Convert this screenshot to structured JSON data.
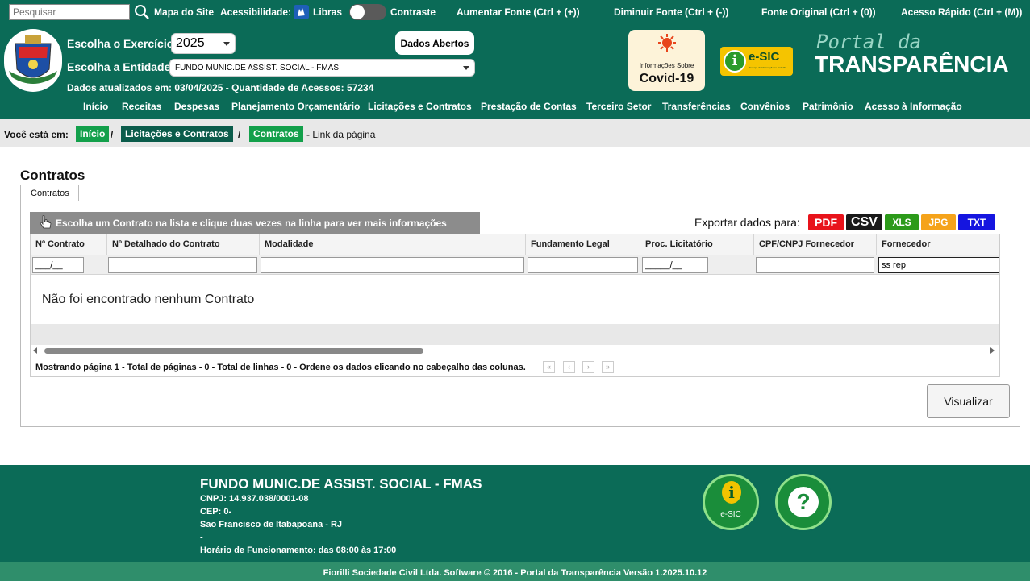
{
  "topbar": {
    "search_placeholder": "Pesquisar",
    "sitemap": "Mapa do Site",
    "accessibility": "Acessibilidade:",
    "libras": "Libras",
    "contrast": "Contraste",
    "increase_font": "Aumentar Fonte (Ctrl + (+))",
    "decrease_font": "Diminuir Fonte (Ctrl + (-))",
    "original_font": "Fonte Original (Ctrl + (0))",
    "quick_access": "Acesso Rápido (Ctrl + (M))"
  },
  "header": {
    "exercise_label": "Escolha o Exercício:",
    "exercise_value": "2025",
    "entity_label": "Escolha a Entidade:",
    "entity_value": "FUNDO MUNIC.DE ASSIST. SOCIAL - FMAS",
    "updated": "Dados atualizados em: 03/04/2025 - Quantidade de Acessos: 57234",
    "open_data": "Dados Abertos",
    "covid_small": "Informações Sobre",
    "covid_big": "Covid-19",
    "esic": "e-SIC",
    "esic_sub": "Serviço de Informação ao Cidadão",
    "portal_line1": "Portal da",
    "portal_line2": "TRANSPARÊNCIA"
  },
  "nav": [
    "Início",
    "Receitas",
    "Despesas",
    "Planejamento Orçamentário",
    "Licitações e Contratos",
    "Prestação de Contas",
    "Terceiro Setor",
    "Transferências",
    "Convênios",
    "Patrimônio",
    "Acesso à Informação"
  ],
  "breadcrumb": {
    "prefix": "Você está em:",
    "items": [
      "Início",
      "Licitações e Contratos",
      "Contratos"
    ],
    "suffix": "- Link da página"
  },
  "page": {
    "title": "Contratos",
    "tab": "Contratos",
    "hint": "Escolha um Contrato na lista e clique duas vezes na linha para ver mais informações",
    "export_label": "Exportar dados para:",
    "exports": [
      "PDF",
      "CSV",
      "XLS",
      "JPG",
      "TXT"
    ]
  },
  "grid": {
    "columns": [
      "Nº Contrato",
      "Nº Detalhado do Contrato",
      "Modalidade",
      "Fundamento Legal",
      "Proc. Licitatório",
      "CPF/CNPJ Fornecedor",
      "Fornecedor"
    ],
    "filters": [
      "___/__",
      "",
      "",
      "",
      "_____/__",
      "",
      "ss rep"
    ],
    "empty_message": "Não foi encontrado nenhum Contrato",
    "pager": "Mostrando página 1 - Total de páginas - 0 - Total de linhas - 0 - Ordene os dados clicando no cabeçalho das colunas.",
    "pager_buttons": [
      "«",
      "‹",
      "›",
      "»"
    ]
  },
  "actions": {
    "view": "Visualizar"
  },
  "footer": {
    "entity": "FUNDO MUNIC.DE ASSIST. SOCIAL - FMAS",
    "cnpj": "CNPJ: 14.937.038/0001-08",
    "cep": "CEP: 0-",
    "city": "Sao Francisco de Itabapoana - RJ",
    "dash": "-",
    "hours": "Horário de Funcionamento: das 08:00 às 17:00",
    "esic_label": "e-SIC",
    "help_mark": "?",
    "info_mark": "i",
    "copyright": "Fiorilli Sociedade Civil Ltda. Software © 2016 - Portal da Transparência Versão 1.2025.10.12"
  },
  "colors": {
    "primary": "#0b6b57",
    "breadcrumb_green": "#13a04b",
    "breadcrumb_dark": "#0b5c4b",
    "pdf": "#e8131b",
    "csv": "#1a1a1a",
    "xls": "#2c9a1a",
    "jpg": "#f5a31a",
    "txt": "#1515e0"
  }
}
